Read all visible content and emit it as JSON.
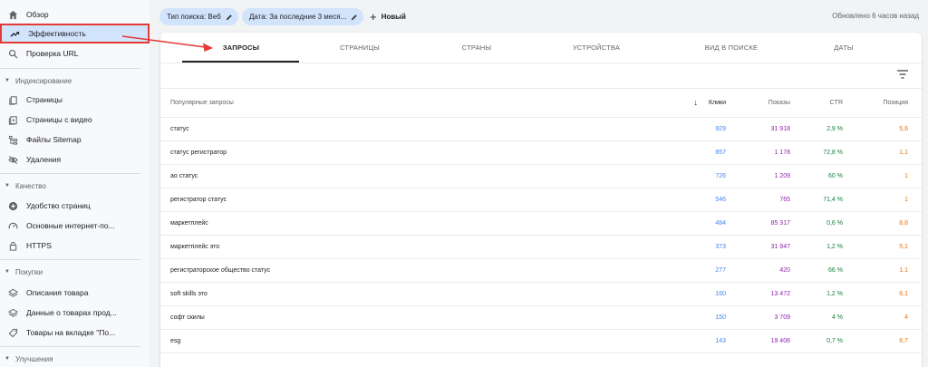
{
  "sidebar": {
    "overview": "Обзор",
    "performance": "Эффективность",
    "url_inspection": "Проверка URL",
    "section_indexing": "Индексирование",
    "pages": "Страницы",
    "video_pages": "Страницы с видео",
    "sitemaps": "Файлы Sitemap",
    "removals": "Удаления",
    "section_experience": "Качество",
    "page_experience": "Удобство страниц",
    "core_web_vitals": "Основные интернет-по...",
    "https": "HTTPS",
    "section_shopping": "Покупки",
    "product_snippets": "Описания товара",
    "merchant_listings": "Данные о товарах прод...",
    "shopping_tab": "Товары на вкладке \"По...",
    "section_enhancements": "Улучшения"
  },
  "topbar": {
    "search_type_chip": "Тип поиска: Веб",
    "date_chip": "Дата: За последние 3 меся...",
    "new_button": "Новый",
    "updated": "Обновлено 6 часов назад"
  },
  "tabs": [
    "ЗАПРОСЫ",
    "СТРАНИЦЫ",
    "СТРАНЫ",
    "УСТРОЙСТВА",
    "ВИД В ПОИСКЕ",
    "ДАТЫ"
  ],
  "table": {
    "headers": {
      "query": "Популярные запросы",
      "clicks": "Клики",
      "impressions": "Показы",
      "ctr": "CTR",
      "position": "Позиция"
    },
    "rows": [
      {
        "query": "статус",
        "clicks": "929",
        "impressions": "31 918",
        "ctr": "2,9 %",
        "position": "5,6"
      },
      {
        "query": "статус регистратор",
        "clicks": "857",
        "impressions": "1 178",
        "ctr": "72,8 %",
        "position": "1,1"
      },
      {
        "query": "ао статус",
        "clicks": "726",
        "impressions": "1 209",
        "ctr": "60 %",
        "position": "1"
      },
      {
        "query": "регистратор статус",
        "clicks": "546",
        "impressions": "765",
        "ctr": "71,4 %",
        "position": "1"
      },
      {
        "query": "маркетплейс",
        "clicks": "484",
        "impressions": "85 317",
        "ctr": "0,6 %",
        "position": "8,8"
      },
      {
        "query": "маркетплейс это",
        "clicks": "373",
        "impressions": "31 947",
        "ctr": "1,2 %",
        "position": "5,1"
      },
      {
        "query": "регистраторское общество статус",
        "clicks": "277",
        "impressions": "420",
        "ctr": "66 %",
        "position": "1,1"
      },
      {
        "query": "soft skills это",
        "clicks": "160",
        "impressions": "13 472",
        "ctr": "1,2 %",
        "position": "6,1"
      },
      {
        "query": "софт скилы",
        "clicks": "150",
        "impressions": "3 709",
        "ctr": "4 %",
        "position": "4"
      },
      {
        "query": "esg",
        "clicks": "143",
        "impressions": "19 406",
        "ctr": "0,7 %",
        "position": "6,7"
      }
    ]
  },
  "colors": {
    "clicks": "#4285f4",
    "impressions": "#8e24aa",
    "ctr": "#188038",
    "position": "#e8710a",
    "annotation": "#e53935"
  }
}
